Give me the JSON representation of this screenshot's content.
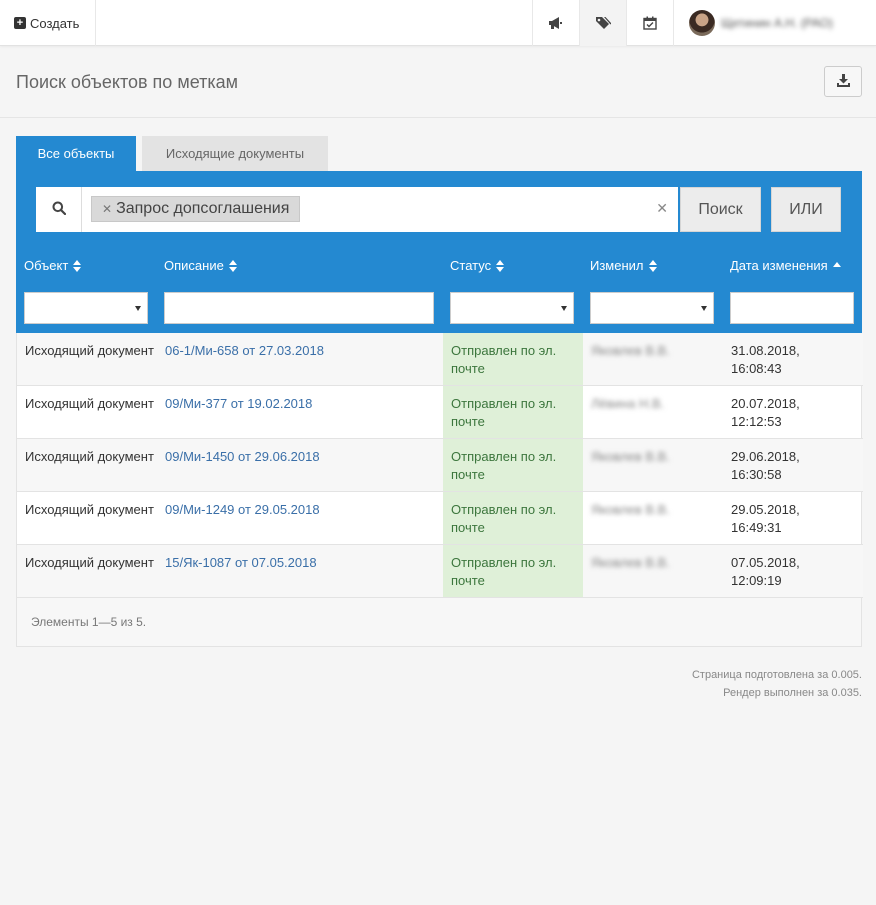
{
  "topnav": {
    "create_label": "Создать",
    "icons": [
      "megaphone-icon",
      "tags-icon",
      "calendar-check-icon"
    ],
    "user_name": "Щетинин А.Н. (РАО)"
  },
  "header": {
    "title": "Поиск объектов по меткам"
  },
  "tabs": [
    {
      "label": "Все объекты",
      "active": true
    },
    {
      "label": "Исходящие документы",
      "active": false
    }
  ],
  "search": {
    "tag": "Запрос допсоглашения",
    "search_button": "Поиск",
    "or_button": "ИЛИ"
  },
  "columns": [
    {
      "label": "Объект"
    },
    {
      "label": "Описание"
    },
    {
      "label": "Статус"
    },
    {
      "label": "Изменил"
    },
    {
      "label": "Дата изменения"
    }
  ],
  "rows": [
    {
      "object": "Исходящий документ",
      "description": "06-1/Ми-658 от 27.03.2018",
      "status": "Отправлен по эл. почте",
      "user": "Яковлев В.В.",
      "date": "31.08.2018, 16:08:43"
    },
    {
      "object": "Исходящий документ",
      "description": "09/Ми-377 от 19.02.2018",
      "status": "Отправлен по эл. почте",
      "user": "Лёвина Н.В.",
      "date": "20.07.2018, 12:12:53"
    },
    {
      "object": "Исходящий документ",
      "description": "09/Ми-1450 от 29.06.2018",
      "status": "Отправлен по эл. почте",
      "user": "Яковлев В.В.",
      "date": "29.06.2018, 16:30:58"
    },
    {
      "object": "Исходящий документ",
      "description": "09/Ми-1249 от 29.05.2018",
      "status": "Отправлен по эл. почте",
      "user": "Яковлев В.В.",
      "date": "29.05.2018, 16:49:31"
    },
    {
      "object": "Исходящий документ",
      "description": "15/Як-1087 от 07.05.2018",
      "status": "Отправлен по эл. почте",
      "user": "Яковлев В.В.",
      "date": "07.05.2018, 12:09:19"
    }
  ],
  "footer": {
    "count_text": "Элементы 1—5 из 5."
  },
  "render_info": {
    "line1": "Страница подготовлена за 0.005.",
    "line2": "Рендер выполнен за 0.035."
  },
  "colors": {
    "accent": "#2489d1",
    "status_bg": "#dff0d8",
    "status_text": "#3c763d",
    "link": "#3a6fa8"
  }
}
